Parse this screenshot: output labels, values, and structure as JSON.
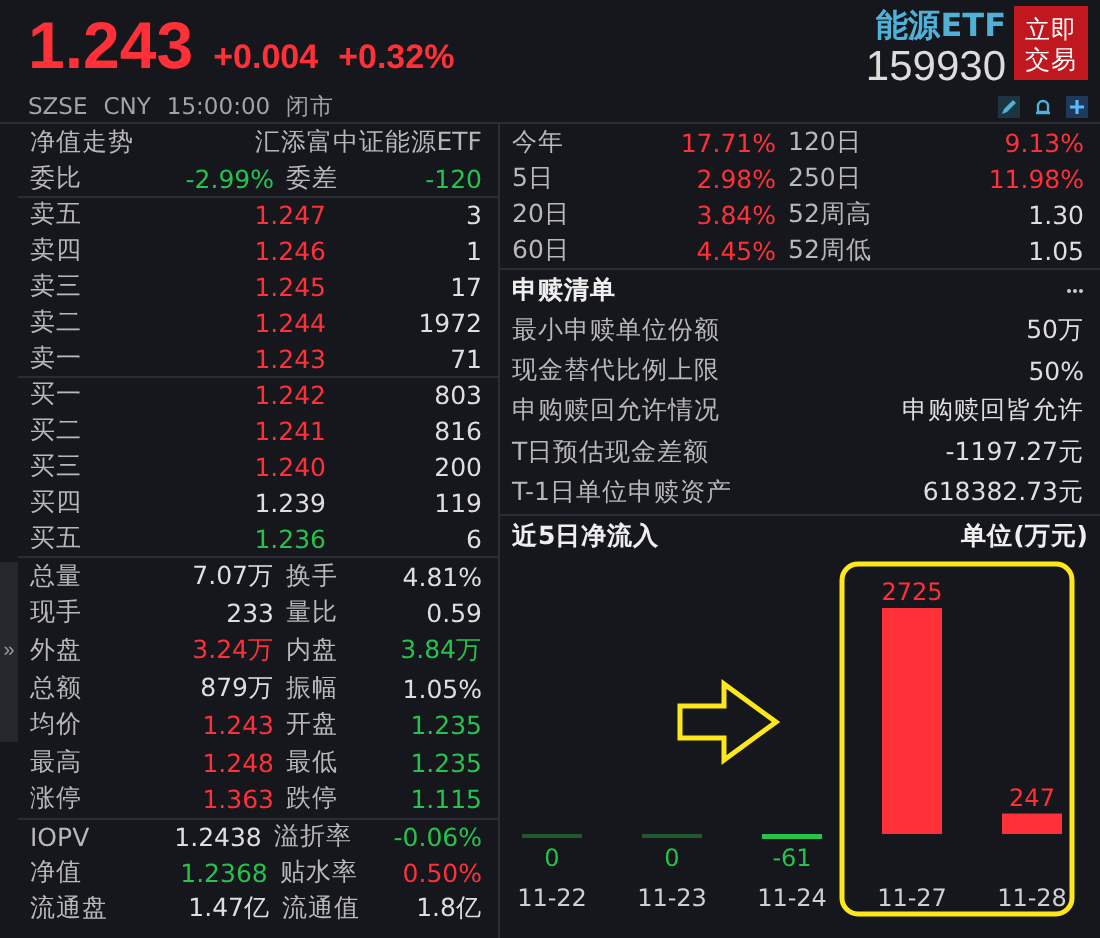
{
  "quote": {
    "price": "1.243",
    "change": "+0.004",
    "change_pct": "+0.32%",
    "exchange": "SZSE",
    "currency": "CNY",
    "time": "15:00:00",
    "status": "闭市",
    "color": "#ff3038"
  },
  "fund": {
    "name": "能源ETF",
    "code": "159930",
    "trade_button": [
      "立即",
      "交易"
    ]
  },
  "side_toggle": "»",
  "book_header": {
    "title": "净值走势",
    "name": "汇添富中证能源ETF"
  },
  "ratio": [
    {
      "label": "委比",
      "value": "-2.99%",
      "color": "#27c24c"
    },
    {
      "label": "委差",
      "value": "-120",
      "color": "#27c24c"
    }
  ],
  "asks": [
    {
      "label": "卖五",
      "price": "1.247",
      "volume": "3",
      "color": "#ff3038"
    },
    {
      "label": "卖四",
      "price": "1.246",
      "volume": "1",
      "color": "#ff3038"
    },
    {
      "label": "卖三",
      "price": "1.245",
      "volume": "17",
      "color": "#ff3038"
    },
    {
      "label": "卖二",
      "price": "1.244",
      "volume": "1972",
      "color": "#ff3038"
    },
    {
      "label": "卖一",
      "price": "1.243",
      "volume": "71",
      "color": "#ff3038"
    }
  ],
  "bids": [
    {
      "label": "买一",
      "price": "1.242",
      "volume": "803",
      "color": "#ff3038"
    },
    {
      "label": "买二",
      "price": "1.241",
      "volume": "816",
      "color": "#ff3038"
    },
    {
      "label": "买三",
      "price": "1.240",
      "volume": "200",
      "color": "#ff3038"
    },
    {
      "label": "买四",
      "price": "1.239",
      "volume": "119",
      "color": "#dedede"
    },
    {
      "label": "买五",
      "price": "1.236",
      "volume": "6",
      "color": "#27c24c"
    }
  ],
  "stats": [
    [
      {
        "label": "总量",
        "value": "7.07万",
        "color": "#dedede"
      },
      {
        "label": "换手",
        "value": "4.81%",
        "color": "#dedede"
      }
    ],
    [
      {
        "label": "现手",
        "value": "233",
        "color": "#dedede"
      },
      {
        "label": "量比",
        "value": "0.59",
        "color": "#dedede"
      }
    ],
    [
      {
        "label": "外盘",
        "value": "3.24万",
        "color": "#ff3038"
      },
      {
        "label": "内盘",
        "value": "3.84万",
        "color": "#27c24c"
      }
    ],
    [
      {
        "label": "总额",
        "value": "879万",
        "color": "#dedede"
      },
      {
        "label": "振幅",
        "value": "1.05%",
        "color": "#dedede"
      }
    ],
    [
      {
        "label": "均价",
        "value": "1.243",
        "color": "#ff3038"
      },
      {
        "label": "开盘",
        "value": "1.235",
        "color": "#27c24c"
      }
    ],
    [
      {
        "label": "最高",
        "value": "1.248",
        "color": "#ff3038"
      },
      {
        "label": "最低",
        "value": "1.235",
        "color": "#27c24c"
      }
    ],
    [
      {
        "label": "涨停",
        "value": "1.363",
        "color": "#ff3038"
      },
      {
        "label": "跌停",
        "value": "1.115",
        "color": "#27c24c"
      }
    ]
  ],
  "nav": [
    [
      {
        "label": "IOPV",
        "value": "1.2438",
        "color": "#dedede"
      },
      {
        "label": "溢折率",
        "value": "-0.06%",
        "color": "#27c24c"
      }
    ],
    [
      {
        "label": "净值",
        "value": "1.2368",
        "color": "#27c24c"
      },
      {
        "label": "贴水率",
        "value": "0.50%",
        "color": "#ff3038"
      }
    ],
    [
      {
        "label": "流通盘",
        "value": "1.47亿",
        "color": "#dedede"
      },
      {
        "label": "流通值",
        "value": "1.8亿",
        "color": "#dedede"
      }
    ]
  ],
  "returns": [
    [
      {
        "label": "今年",
        "value": "17.71%",
        "color": "#ff3038"
      },
      {
        "label": "120日",
        "value": "9.13%",
        "color": "#ff3038"
      }
    ],
    [
      {
        "label": "5日",
        "value": "2.98%",
        "color": "#ff3038"
      },
      {
        "label": "250日",
        "value": "11.98%",
        "color": "#ff3038"
      }
    ],
    [
      {
        "label": "20日",
        "value": "3.84%",
        "color": "#ff3038"
      },
      {
        "label": "52周高",
        "value": "1.30",
        "color": "#dedede"
      }
    ],
    [
      {
        "label": "60日",
        "value": "4.45%",
        "color": "#ff3038"
      },
      {
        "label": "52周低",
        "value": "1.05",
        "color": "#dedede"
      }
    ]
  ],
  "subscription": {
    "title": "申赎清单",
    "items": [
      {
        "label": "最小申赎单位份额",
        "value": "50万"
      },
      {
        "label": "现金替代比例上限",
        "value": "50%"
      },
      {
        "label": "申购赎回允许情况",
        "value": "申购赎回皆允许"
      },
      {
        "label": "T日预估现金差额",
        "value": "-1197.27元"
      },
      {
        "label": "T-1日单位申赎资产",
        "value": "618382.73元"
      }
    ]
  },
  "flow_chart": {
    "chart_data": {
      "type": "bar",
      "title": "近5日净流入",
      "ylabel": "单位(万元)",
      "categories": [
        "11-22",
        "11-23",
        "11-24",
        "11-27",
        "11-28"
      ],
      "values": [
        0,
        0,
        -61,
        2725,
        247
      ],
      "data_labels": true
    }
  }
}
